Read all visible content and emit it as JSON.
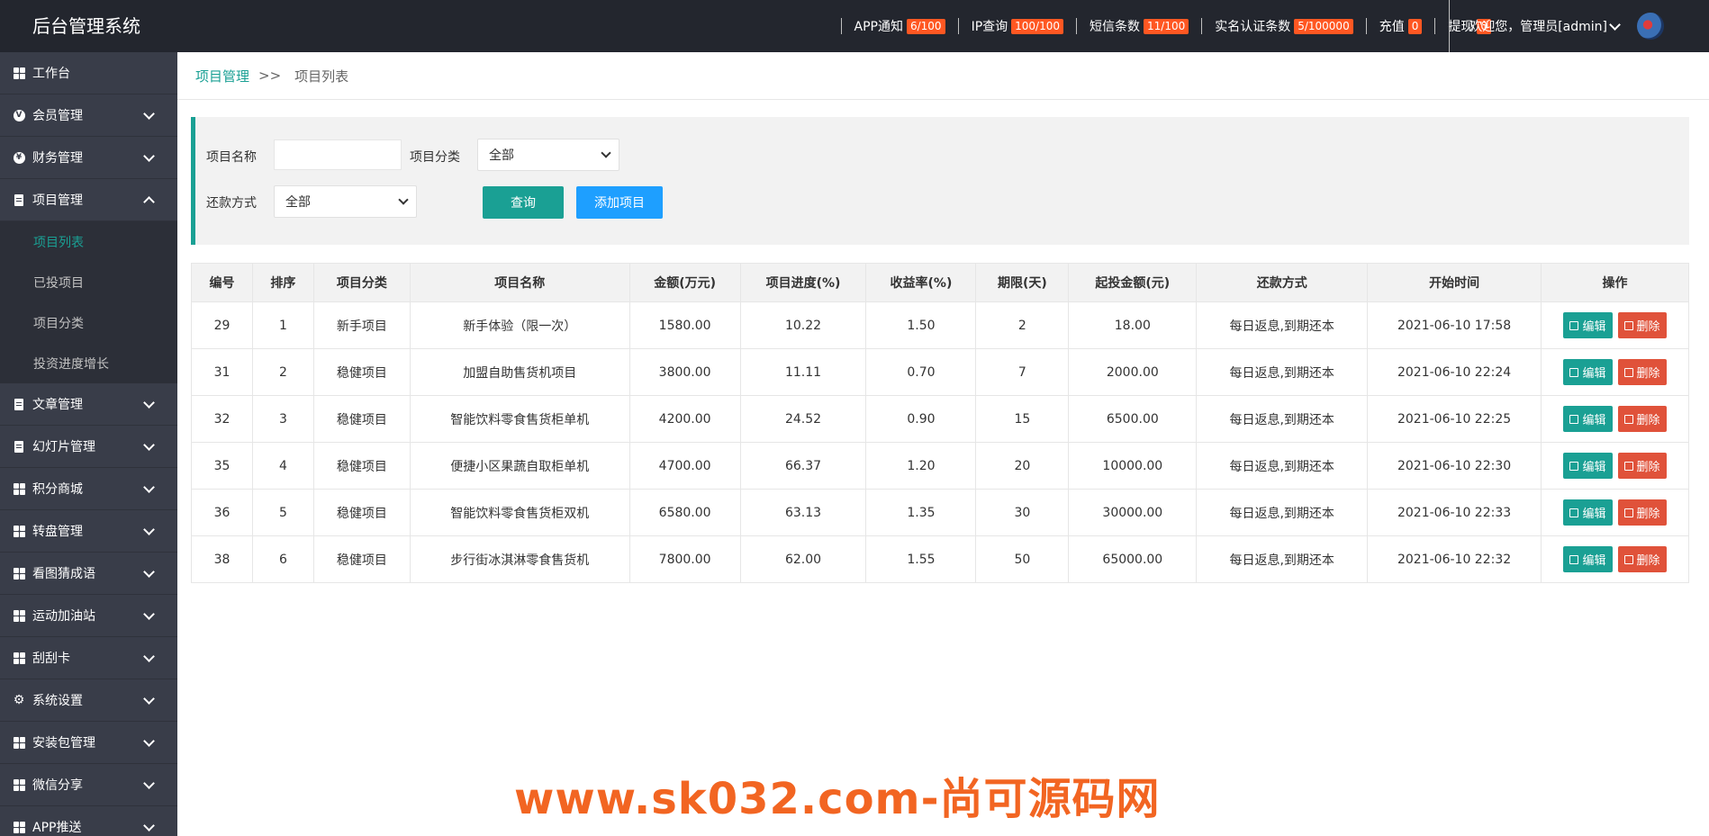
{
  "header": {
    "title": "后台管理系统",
    "stats": [
      {
        "label": "APP通知",
        "badge": "6/100"
      },
      {
        "label": "IP查询",
        "badge": "100/100"
      },
      {
        "label": "短信条数",
        "badge": "11/100"
      },
      {
        "label": "实名认证条数",
        "badge": "5/100000"
      },
      {
        "label": "充值",
        "badge": "0"
      },
      {
        "label": "提现",
        "badge": "0"
      }
    ],
    "welcome": "欢迎您，管理员[admin]"
  },
  "sidebar": {
    "items": [
      {
        "label": "工作台",
        "icon": "dashboard-icon"
      },
      {
        "label": "会员管理",
        "icon": "member-icon"
      },
      {
        "label": "财务管理",
        "icon": "finance-icon"
      },
      {
        "label": "项目管理",
        "icon": "project-icon"
      },
      {
        "label": "文章管理",
        "icon": "article-icon"
      },
      {
        "label": "幻灯片管理",
        "icon": "slideshow-icon"
      },
      {
        "label": "积分商城",
        "icon": "points-mall-icon"
      },
      {
        "label": "转盘管理",
        "icon": "wheel-icon"
      },
      {
        "label": "看图猜成语",
        "icon": "idiom-icon"
      },
      {
        "label": "运动加油站",
        "icon": "sport-icon"
      },
      {
        "label": "刮刮卡",
        "icon": "scratch-card-icon"
      },
      {
        "label": "系统设置",
        "icon": "gear-icon"
      },
      {
        "label": "安装包管理",
        "icon": "package-icon"
      },
      {
        "label": "微信分享",
        "icon": "wechat-icon"
      },
      {
        "label": "APP推送",
        "icon": "push-icon"
      }
    ],
    "project_sub": [
      "项目列表",
      "已投项目",
      "项目分类",
      "投资进度增长"
    ]
  },
  "breadcrumb": {
    "parent": "项目管理",
    "separator": ">>",
    "current": "项目列表"
  },
  "filter": {
    "name_label": "项目名称",
    "name_value": "",
    "category_label": "项目分类",
    "category_value": "全部",
    "repay_label": "还款方式",
    "repay_value": "全部",
    "search_button": "查询",
    "add_button": "添加项目"
  },
  "table": {
    "headers": [
      "编号",
      "排序",
      "项目分类",
      "项目名称",
      "金额(万元)",
      "项目进度(%)",
      "收益率(%)",
      "期限(天)",
      "起投金额(元)",
      "还款方式",
      "开始时间",
      "操作"
    ],
    "edit_label": "编辑",
    "delete_label": "删除",
    "rows": [
      [
        "29",
        "1",
        "新手项目",
        "新手体验（限一次）",
        "1580.00",
        "10.22",
        "1.50",
        "2",
        "18.00",
        "每日返息,到期还本",
        "2021-06-10 17:58"
      ],
      [
        "31",
        "2",
        "稳健项目",
        "加盟自助售货机项目",
        "3800.00",
        "11.11",
        "0.70",
        "7",
        "2000.00",
        "每日返息,到期还本",
        "2021-06-10 22:24"
      ],
      [
        "32",
        "3",
        "稳健项目",
        "智能饮料零食售货柜单机",
        "4200.00",
        "24.52",
        "0.90",
        "15",
        "6500.00",
        "每日返息,到期还本",
        "2021-06-10 22:25"
      ],
      [
        "35",
        "4",
        "稳健项目",
        "便捷小区果蔬自取柜单机",
        "4700.00",
        "66.37",
        "1.20",
        "20",
        "10000.00",
        "每日返息,到期还本",
        "2021-06-10 22:30"
      ],
      [
        "36",
        "5",
        "稳健项目",
        "智能饮料零食售货柜双机",
        "6580.00",
        "63.13",
        "1.35",
        "30",
        "30000.00",
        "每日返息,到期还本",
        "2021-06-10 22:33"
      ],
      [
        "38",
        "6",
        "稳健项目",
        "步行街冰淇淋零食售货机",
        "7800.00",
        "62.00",
        "1.55",
        "50",
        "65000.00",
        "每日返息,到期还本",
        "2021-06-10 22:32"
      ]
    ]
  },
  "watermark": "www.sk032.com-尚可源码网",
  "colors": {
    "accent": "#1aa094",
    "badge": "#ff5722",
    "sidebar": "#393d49",
    "topbar": "#23262e",
    "blue_button": "#1e9fff",
    "delete": "#e0523a"
  }
}
